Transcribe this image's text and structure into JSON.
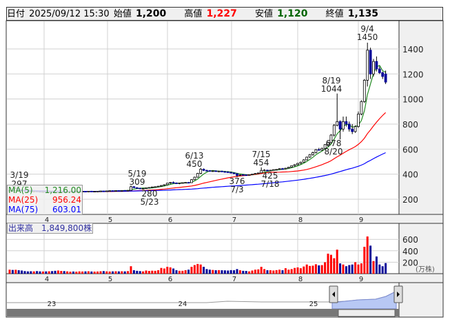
{
  "header": {
    "date_label": "日付",
    "date": "2025/09/12 15:30",
    "open_label": "始値",
    "open": "1,200",
    "high_label": "高値",
    "high": "1,227",
    "low_label": "安値",
    "low": "1,120",
    "close_label": "終値",
    "close": "1,135"
  },
  "colors": {
    "up_volume": "#ff0000",
    "down_volume": "#000099",
    "ma5": "#228b22",
    "ma25": "#ff0000",
    "ma75": "#0000ff",
    "high_text": "#ff0000",
    "low_text": "#006400"
  },
  "legend": {
    "ma5_label": "MA(5)",
    "ma5": "1,216.00",
    "ma25_label": "MA(25)",
    "ma25": "956.24",
    "ma75_label": "MA(75)",
    "ma75": "603.01"
  },
  "volume_label": "出来高　1,849,800株",
  "annotations": [
    {
      "date": "3/19",
      "value": "297"
    },
    {
      "date": "5/19",
      "value": "309"
    },
    {
      "value": "280",
      "date": "5/23"
    },
    {
      "date": "6/13",
      "value": "450"
    },
    {
      "value": "376",
      "date": "7/3"
    },
    {
      "date": "7/15",
      "value": "454"
    },
    {
      "value": "425",
      "date": "7/18"
    },
    {
      "date": "8/19",
      "value": "1044"
    },
    {
      "value": "678",
      "date": "8/20"
    },
    {
      "date": "9/4",
      "value": "1450"
    }
  ],
  "chart_data": {
    "type": "candlestick",
    "price_axis": {
      "ticks": [
        200,
        400,
        600,
        800,
        1000,
        1200,
        1400
      ]
    },
    "volume_axis": {
      "ticks": [
        200,
        400,
        600
      ],
      "unit": "(万株)"
    },
    "month_labels": [
      "4",
      "5",
      "6",
      "7",
      "8",
      "9"
    ],
    "navigator_labels": [
      "23",
      "24",
      "25"
    ],
    "ohlcv": [
      [
        268,
        272,
        264,
        270,
        70
      ],
      [
        270,
        275,
        266,
        268,
        65
      ],
      [
        268,
        297,
        266,
        285,
        68
      ],
      [
        285,
        288,
        270,
        272,
        60
      ],
      [
        272,
        275,
        265,
        268,
        55
      ],
      [
        268,
        270,
        262,
        266,
        45
      ],
      [
        266,
        268,
        262,
        264,
        40
      ],
      [
        264,
        266,
        258,
        262,
        42
      ],
      [
        262,
        266,
        258,
        264,
        40
      ],
      [
        264,
        268,
        260,
        262,
        45
      ],
      [
        262,
        264,
        256,
        258,
        40
      ],
      [
        258,
        262,
        254,
        260,
        38
      ],
      [
        260,
        264,
        256,
        258,
        40
      ],
      [
        258,
        262,
        255,
        260,
        42
      ],
      [
        260,
        263,
        256,
        258,
        45
      ],
      [
        258,
        262,
        254,
        256,
        50
      ],
      [
        256,
        260,
        252,
        258,
        55
      ],
      [
        258,
        262,
        255,
        260,
        48
      ],
      [
        260,
        263,
        256,
        258,
        45
      ],
      [
        258,
        262,
        255,
        260,
        40
      ],
      [
        260,
        264,
        257,
        262,
        35
      ],
      [
        262,
        265,
        258,
        260,
        38
      ],
      [
        260,
        263,
        257,
        261,
        35
      ],
      [
        261,
        264,
        258,
        262,
        40
      ],
      [
        262,
        265,
        259,
        263,
        38
      ],
      [
        263,
        266,
        260,
        262,
        40
      ],
      [
        262,
        265,
        259,
        264,
        42
      ],
      [
        264,
        267,
        261,
        262,
        38
      ],
      [
        262,
        265,
        259,
        263,
        36
      ],
      [
        263,
        266,
        260,
        264,
        38
      ],
      [
        264,
        268,
        262,
        265,
        42
      ],
      [
        265,
        268,
        262,
        264,
        45
      ],
      [
        264,
        268,
        261,
        266,
        40
      ],
      [
        266,
        270,
        263,
        268,
        38
      ],
      [
        268,
        271,
        265,
        267,
        40
      ],
      [
        267,
        270,
        264,
        269,
        42
      ],
      [
        269,
        272,
        266,
        268,
        40
      ],
      [
        268,
        272,
        266,
        270,
        42
      ],
      [
        270,
        273,
        267,
        269,
        40
      ],
      [
        269,
        272,
        266,
        271,
        45
      ],
      [
        271,
        309,
        270,
        300,
        130
      ],
      [
        300,
        305,
        290,
        292,
        60
      ],
      [
        292,
        296,
        286,
        288,
        50
      ],
      [
        288,
        292,
        282,
        284,
        45
      ],
      [
        284,
        288,
        280,
        286,
        40
      ],
      [
        286,
        292,
        284,
        290,
        55
      ],
      [
        290,
        296,
        288,
        294,
        48
      ],
      [
        294,
        300,
        290,
        298,
        52
      ],
      [
        298,
        302,
        294,
        300,
        50
      ],
      [
        300,
        306,
        296,
        304,
        60
      ],
      [
        304,
        312,
        300,
        310,
        100
      ],
      [
        310,
        318,
        306,
        316,
        90
      ],
      [
        316,
        330,
        312,
        328,
        120
      ],
      [
        328,
        336,
        322,
        334,
        110
      ],
      [
        334,
        342,
        328,
        330,
        90
      ],
      [
        330,
        334,
        322,
        326,
        60
      ],
      [
        326,
        332,
        320,
        330,
        50
      ],
      [
        330,
        334,
        326,
        332,
        50
      ],
      [
        332,
        336,
        328,
        334,
        60
      ],
      [
        334,
        338,
        330,
        332,
        70
      ],
      [
        332,
        360,
        330,
        356,
        120
      ],
      [
        356,
        380,
        352,
        376,
        150
      ],
      [
        376,
        410,
        372,
        406,
        170
      ],
      [
        406,
        450,
        400,
        440,
        160
      ],
      [
        440,
        446,
        425,
        430,
        120
      ],
      [
        430,
        436,
        422,
        428,
        80
      ],
      [
        428,
        432,
        420,
        424,
        70
      ],
      [
        424,
        430,
        420,
        426,
        65
      ],
      [
        426,
        430,
        420,
        422,
        60
      ],
      [
        422,
        428,
        418,
        424,
        62
      ],
      [
        424,
        428,
        418,
        420,
        60
      ],
      [
        420,
        426,
        416,
        418,
        58
      ],
      [
        418,
        424,
        412,
        414,
        55
      ],
      [
        414,
        420,
        408,
        410,
        62
      ],
      [
        410,
        414,
        400,
        404,
        60
      ],
      [
        404,
        408,
        376,
        390,
        80
      ],
      [
        390,
        398,
        386,
        396,
        60
      ],
      [
        396,
        400,
        390,
        394,
        50
      ],
      [
        394,
        398,
        388,
        392,
        48
      ],
      [
        392,
        398,
        390,
        396,
        40
      ],
      [
        396,
        402,
        392,
        400,
        55
      ],
      [
        400,
        408,
        398,
        406,
        70
      ],
      [
        406,
        412,
        402,
        410,
        75
      ],
      [
        410,
        454,
        408,
        430,
        120
      ],
      [
        430,
        440,
        425,
        432,
        80
      ],
      [
        432,
        436,
        425,
        428,
        60
      ],
      [
        428,
        434,
        425,
        432,
        60
      ],
      [
        432,
        438,
        428,
        436,
        55
      ],
      [
        436,
        440,
        430,
        438,
        62
      ],
      [
        438,
        446,
        434,
        444,
        70
      ],
      [
        444,
        450,
        438,
        442,
        60
      ],
      [
        442,
        450,
        438,
        448,
        95
      ],
      [
        448,
        458,
        444,
        456,
        70
      ],
      [
        456,
        470,
        452,
        468,
        80
      ],
      [
        468,
        480,
        462,
        476,
        100
      ],
      [
        476,
        490,
        470,
        486,
        110
      ],
      [
        486,
        500,
        480,
        496,
        95
      ],
      [
        496,
        520,
        492,
        514,
        125
      ],
      [
        514,
        540,
        510,
        536,
        160
      ],
      [
        536,
        560,
        530,
        556,
        135
      ],
      [
        556,
        580,
        548,
        572,
        140
      ],
      [
        572,
        600,
        566,
        596,
        165
      ],
      [
        596,
        610,
        588,
        592,
        145
      ],
      [
        592,
        612,
        586,
        606,
        150
      ],
      [
        606,
        640,
        600,
        636,
        200
      ],
      [
        636,
        660,
        620,
        652,
        350
      ],
      [
        652,
        720,
        646,
        712,
        330
      ],
      [
        712,
        800,
        700,
        790,
        270
      ],
      [
        790,
        1044,
        782,
        820,
        420
      ],
      [
        820,
        830,
        678,
        760,
        180
      ],
      [
        760,
        860,
        740,
        820,
        160
      ],
      [
        820,
        860,
        780,
        800,
        130
      ],
      [
        800,
        820,
        740,
        760,
        150
      ],
      [
        760,
        800,
        720,
        740,
        160
      ],
      [
        740,
        790,
        730,
        780,
        200
      ],
      [
        780,
        900,
        770,
        880,
        160
      ],
      [
        880,
        990,
        870,
        980,
        180
      ],
      [
        980,
        1160,
        970,
        1150,
        470
      ],
      [
        1150,
        1450,
        1100,
        1390,
        650
      ],
      [
        1390,
        1410,
        1160,
        1200,
        490
      ],
      [
        1200,
        1320,
        1180,
        1300,
        220
      ],
      [
        1300,
        1340,
        1220,
        1240,
        300
      ],
      [
        1240,
        1260,
        1200,
        1210,
        160
      ],
      [
        1210,
        1220,
        1160,
        1180,
        130
      ],
      [
        1200,
        1227,
        1120,
        1135,
        185
      ]
    ]
  }
}
